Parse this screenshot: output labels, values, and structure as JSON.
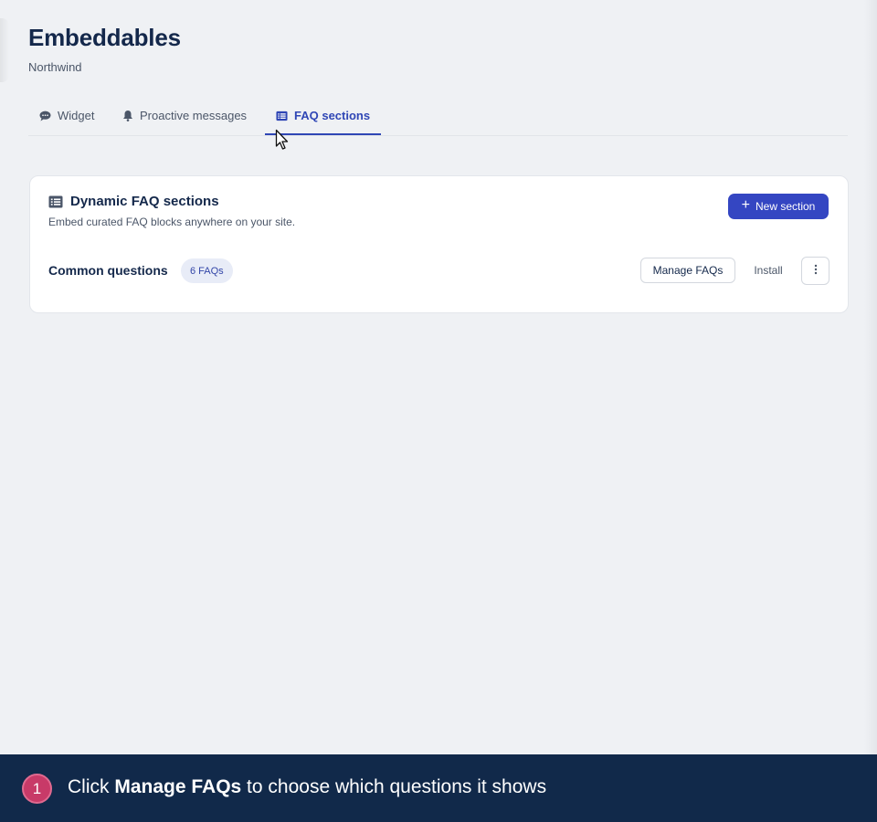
{
  "header": {
    "title": "Embeddables",
    "subtitle": "Northwind"
  },
  "tabs": [
    {
      "label": "Widget",
      "icon": "chat-bubble-icon",
      "active": false
    },
    {
      "label": "Proactive messages",
      "icon": "bell-icon",
      "active": false
    },
    {
      "label": "FAQ sections",
      "icon": "list-icon",
      "active": true
    }
  ],
  "card": {
    "icon": "list-icon",
    "title": "Dynamic FAQ sections",
    "description": "Embed curated FAQ blocks anywhere on your site.",
    "new_button": "New section",
    "rows": [
      {
        "title": "Common questions",
        "badge": "6 FAQs",
        "manage_label": "Manage FAQs",
        "install_label": "Install"
      }
    ]
  },
  "footer": {
    "step_number": "1",
    "text_before": "Click ",
    "text_bold": "Manage FAQs",
    "text_after": " to choose which questions it shows"
  },
  "colors": {
    "accent": "#3446c2",
    "background": "#eff1f4",
    "footer": "#11294a",
    "step_badge": "#c83a68"
  }
}
